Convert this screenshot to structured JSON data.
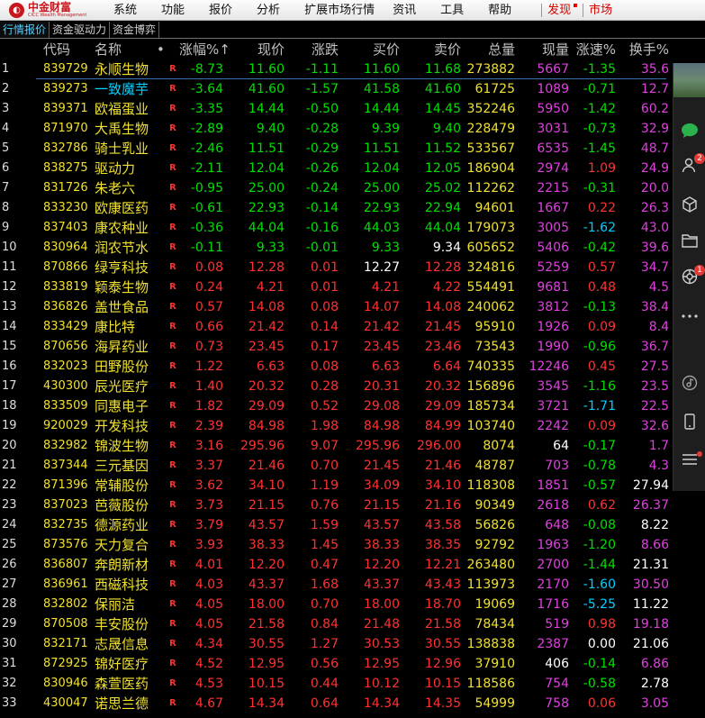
{
  "app": {
    "logo_text": "中金财富",
    "logo_sub": "CICC Wealth Management"
  },
  "menu": [
    "系统",
    "功能",
    "报价",
    "分析",
    "扩展市场行情",
    "资讯",
    "工具",
    "帮助"
  ],
  "menu_red": [
    "发现",
    "市场"
  ],
  "tabs": [
    "行情报价",
    "资金驱动力",
    "资金博弈"
  ],
  "headers": {
    "name": "代码",
    "name2": "名称",
    "dot": "•",
    "c1": "涨幅%↑",
    "c2": "现价",
    "c3": "涨跌",
    "c4": "买价",
    "c5": "卖价",
    "c6": "总量",
    "c7": "现量",
    "c8": "涨速%",
    "c9": "换手%"
  },
  "row_mark": "R",
  "rows": [
    {
      "i": "1",
      "code": "839729",
      "name": "永顺生物",
      "pct": "-8.73",
      "price": "11.60",
      "chg": "-1.11",
      "bid": "11.60",
      "ask": "11.68",
      "vol": "273882",
      "cur": "5667",
      "spd": "-1.35",
      "turn": "35.6"
    },
    {
      "i": "2",
      "code": "839273",
      "name": "一致魔芋",
      "pct": "-3.64",
      "price": "41.60",
      "chg": "-1.57",
      "bid": "41.58",
      "ask": "41.60",
      "vol": "61725",
      "cur": "1089",
      "spd": "-0.71",
      "turn": "12.7"
    },
    {
      "i": "3",
      "code": "839371",
      "name": "欧福蛋业",
      "pct": "-3.35",
      "price": "14.44",
      "chg": "-0.50",
      "bid": "14.44",
      "ask": "14.45",
      "vol": "352246",
      "cur": "5950",
      "spd": "-1.42",
      "turn": "60.2"
    },
    {
      "i": "4",
      "code": "871970",
      "name": "大禹生物",
      "pct": "-2.89",
      "price": "9.40",
      "chg": "-0.28",
      "bid": "9.39",
      "ask": "9.40",
      "vol": "228479",
      "cur": "3031",
      "spd": "-0.73",
      "turn": "32.9"
    },
    {
      "i": "5",
      "code": "832786",
      "name": "骑士乳业",
      "pct": "-2.46",
      "price": "11.51",
      "chg": "-0.29",
      "bid": "11.51",
      "ask": "11.52",
      "vol": "533567",
      "cur": "6535",
      "spd": "-1.45",
      "turn": "48.7"
    },
    {
      "i": "6",
      "code": "838275",
      "name": "驱动力",
      "pct": "-2.11",
      "price": "12.04",
      "chg": "-0.26",
      "bid": "12.04",
      "ask": "12.05",
      "vol": "186904",
      "cur": "2974",
      "spd": "1.09",
      "turn": "24.9"
    },
    {
      "i": "7",
      "code": "831726",
      "name": "朱老六",
      "pct": "-0.95",
      "price": "25.00",
      "chg": "-0.24",
      "bid": "25.00",
      "ask": "25.02",
      "vol": "112262",
      "cur": "2215",
      "spd": "-0.31",
      "turn": "20.0"
    },
    {
      "i": "8",
      "code": "833230",
      "name": "欧康医药",
      "pct": "-0.61",
      "price": "22.93",
      "chg": "-0.14",
      "bid": "22.93",
      "ask": "22.94",
      "vol": "94601",
      "cur": "1667",
      "spd": "0.22",
      "turn": "26.3"
    },
    {
      "i": "9",
      "code": "837403",
      "name": "康农种业",
      "pct": "-0.36",
      "price": "44.04",
      "chg": "-0.16",
      "bid": "44.03",
      "ask": "44.04",
      "vol": "179073",
      "cur": "3005",
      "spd": "-1.62",
      "turn": "43.0"
    },
    {
      "i": "10",
      "code": "830964",
      "name": "润农节水",
      "pct": "-0.11",
      "price": "9.33",
      "chg": "-0.01",
      "bid": "9.33",
      "ask": "9.34",
      "vol": "605652",
      "cur": "5406",
      "spd": "-0.42",
      "turn": "39.6"
    },
    {
      "i": "11",
      "code": "870866",
      "name": "绿亨科技",
      "pct": "0.08",
      "price": "12.28",
      "chg": "0.01",
      "bid": "12.27",
      "ask": "12.28",
      "vol": "324816",
      "cur": "5259",
      "spd": "0.57",
      "turn": "34.7"
    },
    {
      "i": "12",
      "code": "833819",
      "name": "颖泰生物",
      "pct": "0.24",
      "price": "4.21",
      "chg": "0.01",
      "bid": "4.21",
      "ask": "4.22",
      "vol": "554491",
      "cur": "9681",
      "spd": "0.48",
      "turn": "4.5"
    },
    {
      "i": "13",
      "code": "836826",
      "name": "盖世食品",
      "pct": "0.57",
      "price": "14.08",
      "chg": "0.08",
      "bid": "14.07",
      "ask": "14.08",
      "vol": "240062",
      "cur": "3812",
      "spd": "-0.13",
      "turn": "38.4"
    },
    {
      "i": "14",
      "code": "833429",
      "name": "康比特",
      "pct": "0.66",
      "price": "21.42",
      "chg": "0.14",
      "bid": "21.42",
      "ask": "21.45",
      "vol": "95910",
      "cur": "1926",
      "spd": "0.09",
      "turn": "8.4"
    },
    {
      "i": "15",
      "code": "870656",
      "name": "海昇药业",
      "pct": "0.73",
      "price": "23.45",
      "chg": "0.17",
      "bid": "23.45",
      "ask": "23.46",
      "vol": "73543",
      "cur": "1990",
      "spd": "-0.96",
      "turn": "36.7"
    },
    {
      "i": "16",
      "code": "832023",
      "name": "田野股份",
      "pct": "1.22",
      "price": "6.63",
      "chg": "0.08",
      "bid": "6.63",
      "ask": "6.64",
      "vol": "740335",
      "cur": "12246",
      "spd": "0.45",
      "turn": "27.5"
    },
    {
      "i": "17",
      "code": "430300",
      "name": "辰光医疗",
      "pct": "1.40",
      "price": "20.32",
      "chg": "0.28",
      "bid": "20.31",
      "ask": "20.32",
      "vol": "156896",
      "cur": "3545",
      "spd": "-1.16",
      "turn": "23.5"
    },
    {
      "i": "18",
      "code": "833509",
      "name": "同惠电子",
      "pct": "1.82",
      "price": "29.09",
      "chg": "0.52",
      "bid": "29.08",
      "ask": "29.09",
      "vol": "185734",
      "cur": "3721",
      "spd": "-1.71",
      "turn": "22.5"
    },
    {
      "i": "19",
      "code": "920029",
      "name": "开发科技",
      "pct": "2.39",
      "price": "84.98",
      "chg": "1.98",
      "bid": "84.98",
      "ask": "84.99",
      "vol": "103740",
      "cur": "2242",
      "spd": "0.09",
      "turn": "32.6"
    },
    {
      "i": "20",
      "code": "832982",
      "name": "锦波生物",
      "pct": "3.16",
      "price": "295.96",
      "chg": "9.07",
      "bid": "295.96",
      "ask": "296.00",
      "vol": "8074",
      "cur": "64",
      "spd": "-0.17",
      "turn": "1.7"
    },
    {
      "i": "21",
      "code": "837344",
      "name": "三元基因",
      "pct": "3.37",
      "price": "21.46",
      "chg": "0.70",
      "bid": "21.45",
      "ask": "21.46",
      "vol": "48787",
      "cur": "703",
      "spd": "-0.78",
      "turn": "4.3"
    },
    {
      "i": "22",
      "code": "871396",
      "name": "常辅股份",
      "pct": "3.62",
      "price": "34.10",
      "chg": "1.19",
      "bid": "34.09",
      "ask": "34.10",
      "vol": "118308",
      "cur": "1851",
      "spd": "-0.57",
      "turn": "27.94"
    },
    {
      "i": "23",
      "code": "837023",
      "name": "芭薇股份",
      "pct": "3.73",
      "price": "21.15",
      "chg": "0.76",
      "bid": "21.15",
      "ask": "21.16",
      "vol": "90349",
      "cur": "2618",
      "spd": "0.62",
      "turn": "26.37"
    },
    {
      "i": "24",
      "code": "832735",
      "name": "德源药业",
      "pct": "3.79",
      "price": "43.57",
      "chg": "1.59",
      "bid": "43.57",
      "ask": "43.58",
      "vol": "56826",
      "cur": "648",
      "spd": "-0.08",
      "turn": "8.22"
    },
    {
      "i": "25",
      "code": "873576",
      "name": "天力复合",
      "pct": "3.93",
      "price": "38.33",
      "chg": "1.45",
      "bid": "38.33",
      "ask": "38.35",
      "vol": "92792",
      "cur": "1963",
      "spd": "-1.20",
      "turn": "8.66"
    },
    {
      "i": "26",
      "code": "836807",
      "name": "奔朗新材",
      "pct": "4.01",
      "price": "12.20",
      "chg": "0.47",
      "bid": "12.20",
      "ask": "12.21",
      "vol": "263480",
      "cur": "2700",
      "spd": "-1.44",
      "turn": "21.31"
    },
    {
      "i": "27",
      "code": "836961",
      "name": "西磁科技",
      "pct": "4.03",
      "price": "43.37",
      "chg": "1.68",
      "bid": "43.37",
      "ask": "43.43",
      "vol": "113973",
      "cur": "2170",
      "spd": "-1.60",
      "turn": "30.50"
    },
    {
      "i": "28",
      "code": "832802",
      "name": "保丽洁",
      "pct": "4.05",
      "price": "18.00",
      "chg": "0.70",
      "bid": "18.00",
      "ask": "18.70",
      "vol": "19069",
      "cur": "1716",
      "spd": "-5.25",
      "turn": "11.22"
    },
    {
      "i": "29",
      "code": "870508",
      "name": "丰安股份",
      "pct": "4.05",
      "price": "21.58",
      "chg": "0.84",
      "bid": "21.48",
      "ask": "21.58",
      "vol": "78434",
      "cur": "519",
      "spd": "0.98",
      "turn": "19.18"
    },
    {
      "i": "30",
      "code": "832171",
      "name": "志晟信息",
      "pct": "4.34",
      "price": "30.55",
      "chg": "1.27",
      "bid": "30.53",
      "ask": "30.55",
      "vol": "138838",
      "cur": "2387",
      "spd": "0.00",
      "turn": "21.06"
    },
    {
      "i": "31",
      "code": "872925",
      "name": "锦好医疗",
      "pct": "4.52",
      "price": "12.95",
      "chg": "0.56",
      "bid": "12.95",
      "ask": "12.96",
      "vol": "37910",
      "cur": "406",
      "spd": "-0.14",
      "turn": "6.86"
    },
    {
      "i": "32",
      "code": "830946",
      "name": "森萱医药",
      "pct": "4.53",
      "price": "10.15",
      "chg": "0.44",
      "bid": "10.12",
      "ask": "10.15",
      "vol": "118586",
      "cur": "754",
      "spd": "-0.58",
      "turn": "2.78"
    },
    {
      "i": "33",
      "code": "430047",
      "name": "诺思兰德",
      "pct": "4.67",
      "price": "14.34",
      "chg": "0.64",
      "bid": "14.34",
      "ask": "14.35",
      "vol": "54999",
      "cur": "758",
      "spd": "0.06",
      "turn": "3.05"
    }
  ],
  "side_panel": {
    "icons": [
      "photo-thumbnail",
      "chat-icon",
      "contacts-icon",
      "cube-icon",
      "folder-icon",
      "apps-icon",
      "more-icon",
      "music-icon",
      "phone-icon",
      "menu-icon"
    ],
    "contacts_badge": "2",
    "apps_badge": "1"
  },
  "colors": {
    "up": "#ff3232",
    "down": "#00e000",
    "flat": "#ffffff",
    "code": "#f0e030",
    "volume": "#f0e030",
    "cur_vol": "#e040e0",
    "speed_strong": "#00d0ff",
    "selected_name": "#55d0ff"
  }
}
